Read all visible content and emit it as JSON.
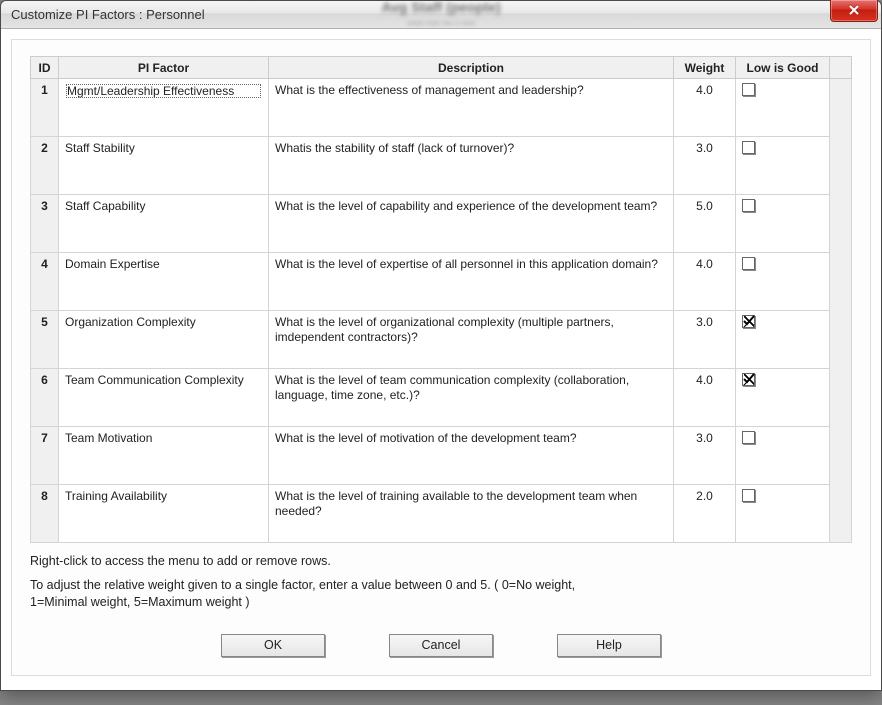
{
  "titlebar": {
    "title": "Customize PI Factors : Personnel",
    "blurred_line1": "Avg Staff (people)",
    "blurred_line2": "-----  ----  --- - ----"
  },
  "headers": {
    "id": "ID",
    "factor": "PI Factor",
    "desc": "Description",
    "weight": "Weight",
    "low": "Low is Good"
  },
  "rows": [
    {
      "id": "1",
      "factor": "Mgmt/Leadership Effectiveness",
      "desc": "What is the effectiveness of management and leadership?",
      "weight": "4.0",
      "low": false,
      "focused": true
    },
    {
      "id": "2",
      "factor": "Staff Stability",
      "desc": "Whatis the stability of staff (lack of turnover)?",
      "weight": "3.0",
      "low": false
    },
    {
      "id": "3",
      "factor": "Staff Capability",
      "desc": "What is the level of capability and experience of the development team?",
      "weight": "5.0",
      "low": false
    },
    {
      "id": "4",
      "factor": "Domain Expertise",
      "desc": "What is the level of expertise of all personnel in this application domain?",
      "weight": "4.0",
      "low": false
    },
    {
      "id": "5",
      "factor": "Organization Complexity",
      "desc": "What is the level of organizational complexity (multiple partners, imdependent contractors)?",
      "weight": "3.0",
      "low": true
    },
    {
      "id": "6",
      "factor": "Team Communication Complexity",
      "desc": "What is the level of team communication complexity (collaboration, language, time zone, etc.)?",
      "weight": "4.0",
      "low": true
    },
    {
      "id": "7",
      "factor": "Team Motivation",
      "desc": "What is the level of motivation of the development team?",
      "weight": "3.0",
      "low": false
    },
    {
      "id": "8",
      "factor": "Training Availability",
      "desc": "What is the level of training available to the development team when needed?",
      "weight": "2.0",
      "low": false
    }
  ],
  "hints": {
    "line1": "Right-click to access the menu to add or remove rows.",
    "line2": "To adjust the relative weight given to a single factor, enter a value between 0 and 5. ( 0=No weight,     1=Minimal weight,       5=Maximum weight )"
  },
  "buttons": {
    "ok": "OK",
    "cancel": "Cancel",
    "help": "Help"
  }
}
